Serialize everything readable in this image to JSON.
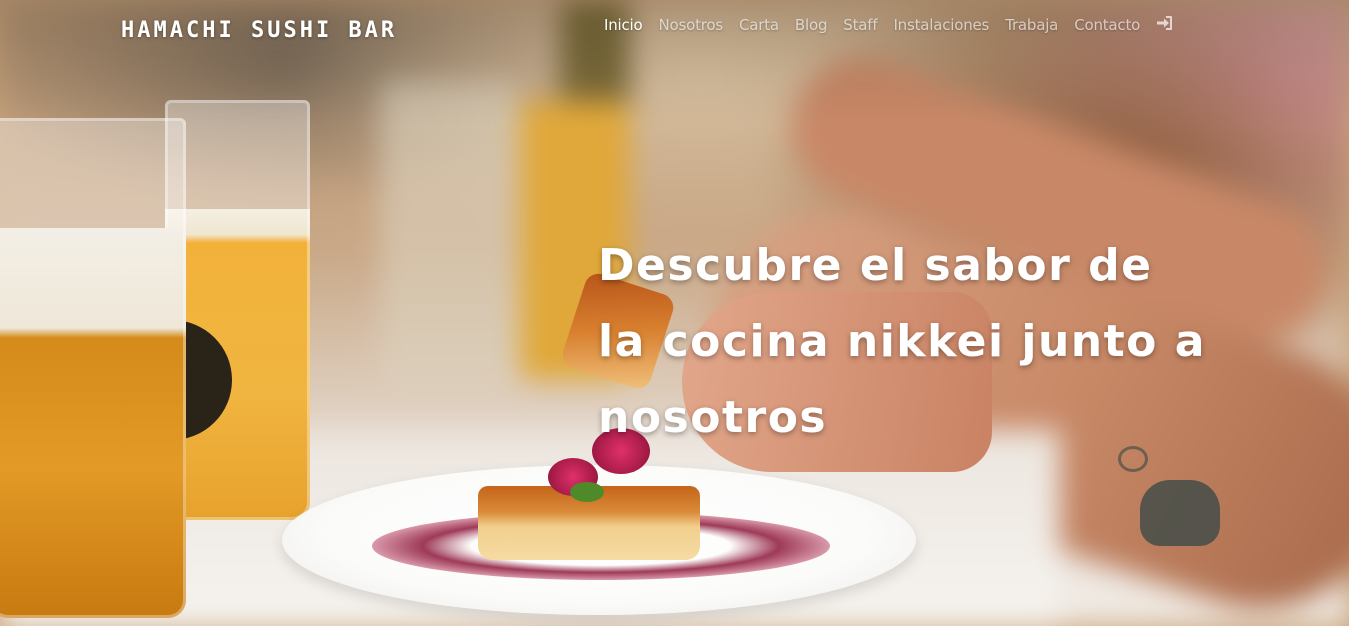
{
  "brand": {
    "name": "HAMACHI SUSHI BAR"
  },
  "nav": {
    "items": [
      {
        "label": "Inicio",
        "active": true
      },
      {
        "label": "Nosotros",
        "active": false
      },
      {
        "label": "Carta",
        "active": false
      },
      {
        "label": "Blog",
        "active": false
      },
      {
        "label": "Staff",
        "active": false
      },
      {
        "label": "Instalaciones",
        "active": false
      },
      {
        "label": "Trabaja",
        "active": false
      },
      {
        "label": "Contacto",
        "active": false
      }
    ],
    "login_icon": "sign-in-icon"
  },
  "hero": {
    "title_line_1": "Descubre el sabor de",
    "title_line_2": "la cocina nikkei junto a",
    "title_line_3": "nosotros"
  },
  "colors": {
    "text_primary": "#ffffff",
    "nav_inactive": "rgba(255,255,255,0.65)"
  }
}
